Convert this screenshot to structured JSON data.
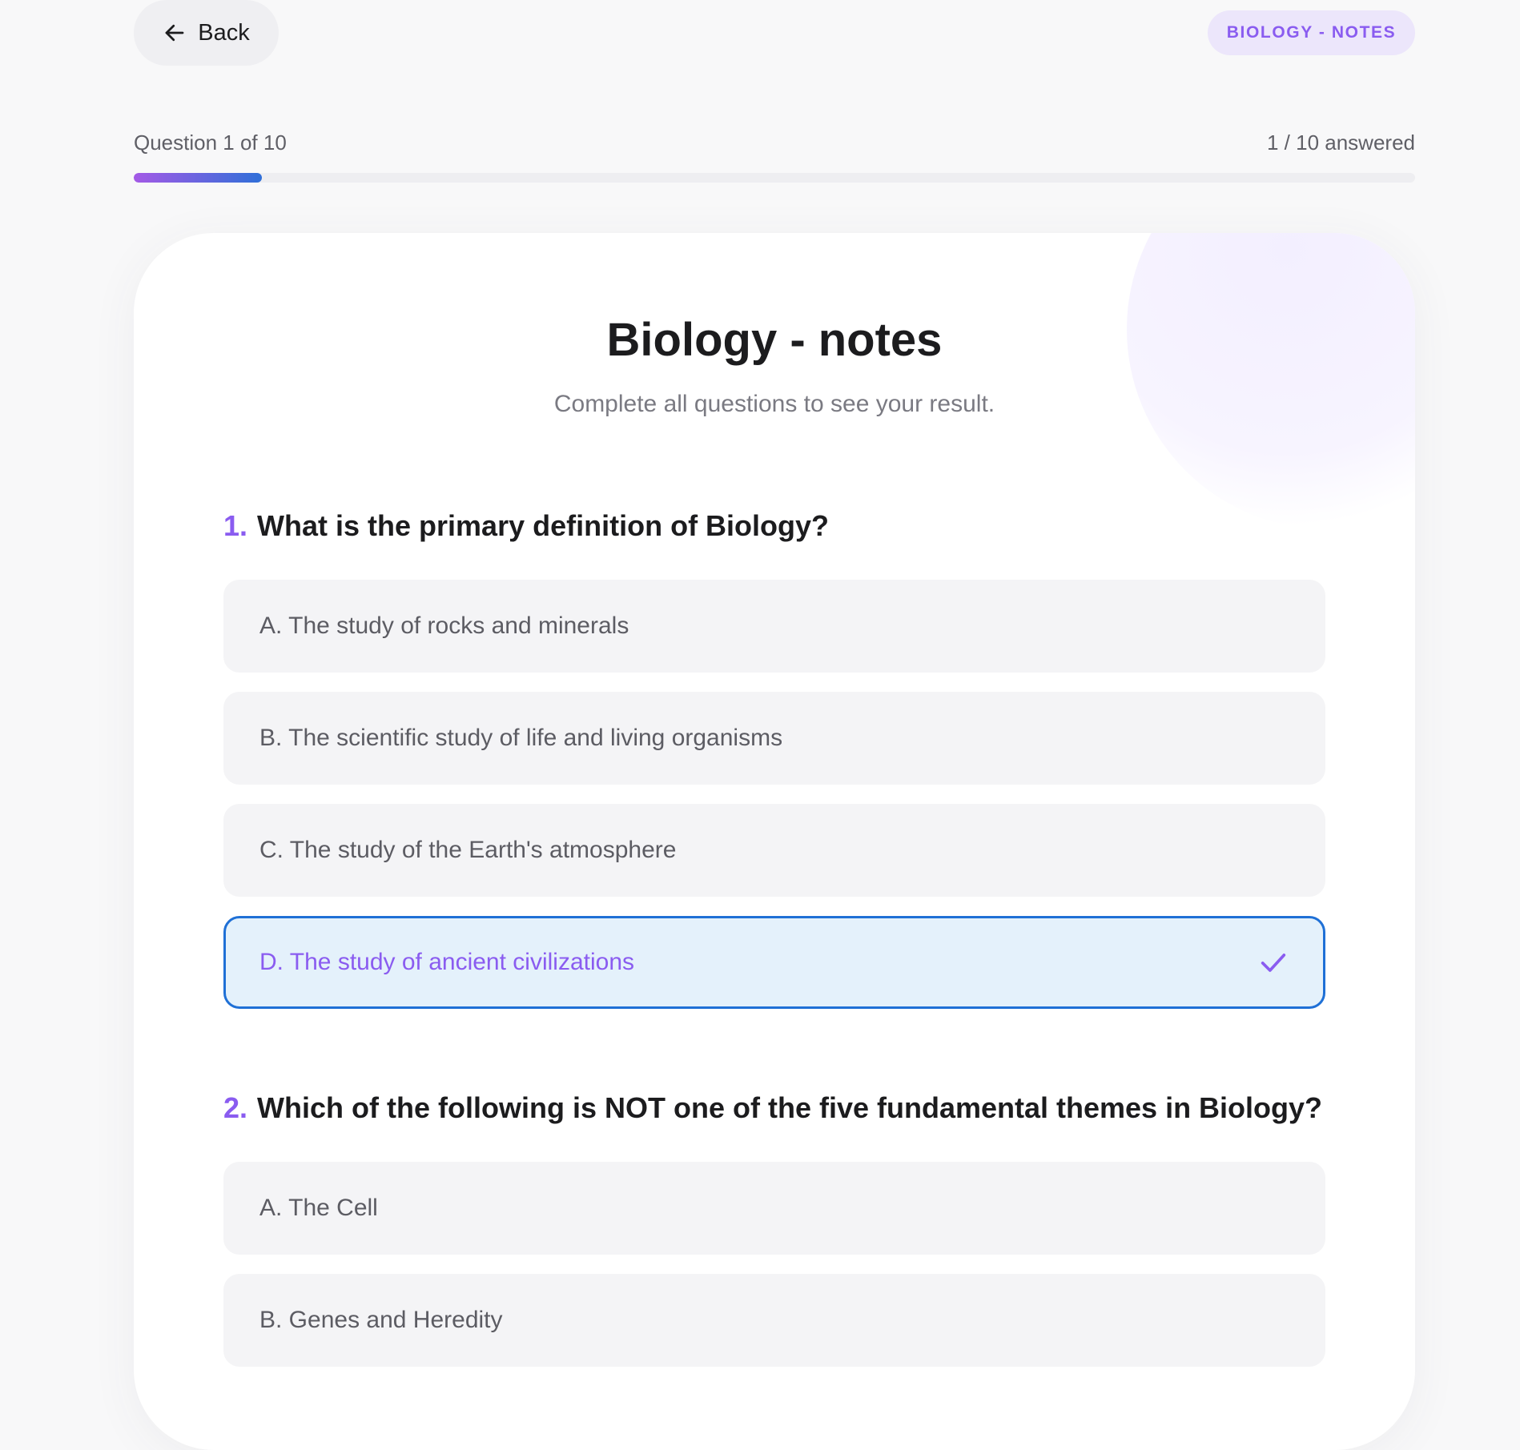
{
  "header": {
    "back_label": "Back",
    "subject_badge": "BIOLOGY - NOTES"
  },
  "progress": {
    "question_label": "Question 1 of 10",
    "answered_label": "1 / 10 answered",
    "answered": 1,
    "total": 10
  },
  "quiz": {
    "title": "Biology - notes",
    "subtitle": "Complete all questions to see your result."
  },
  "questions": [
    {
      "number": "1.",
      "text": "What is the primary definition of Biology?",
      "options": [
        "A. The study of rocks and minerals",
        "B. The scientific study of life and living organisms",
        "C. The study of the Earth's atmosphere",
        "D. The study of ancient civilizations"
      ],
      "selected_option": 3
    },
    {
      "number": "2.",
      "text": "Which of the following is NOT one of the five fundamental themes in Biology?",
      "options": [
        "A. The Cell",
        "B. Genes and Heredity"
      ]
    }
  ],
  "colors": {
    "accent": "#8a5cf0",
    "selected_border": "#1f70d6",
    "selected_background": "#e4f1fb",
    "progress_gradient_start": "#a45ae6",
    "progress_gradient_end": "#2f6fd8"
  },
  "icons": {
    "back": "arrow-left-icon",
    "selected": "check-icon"
  }
}
